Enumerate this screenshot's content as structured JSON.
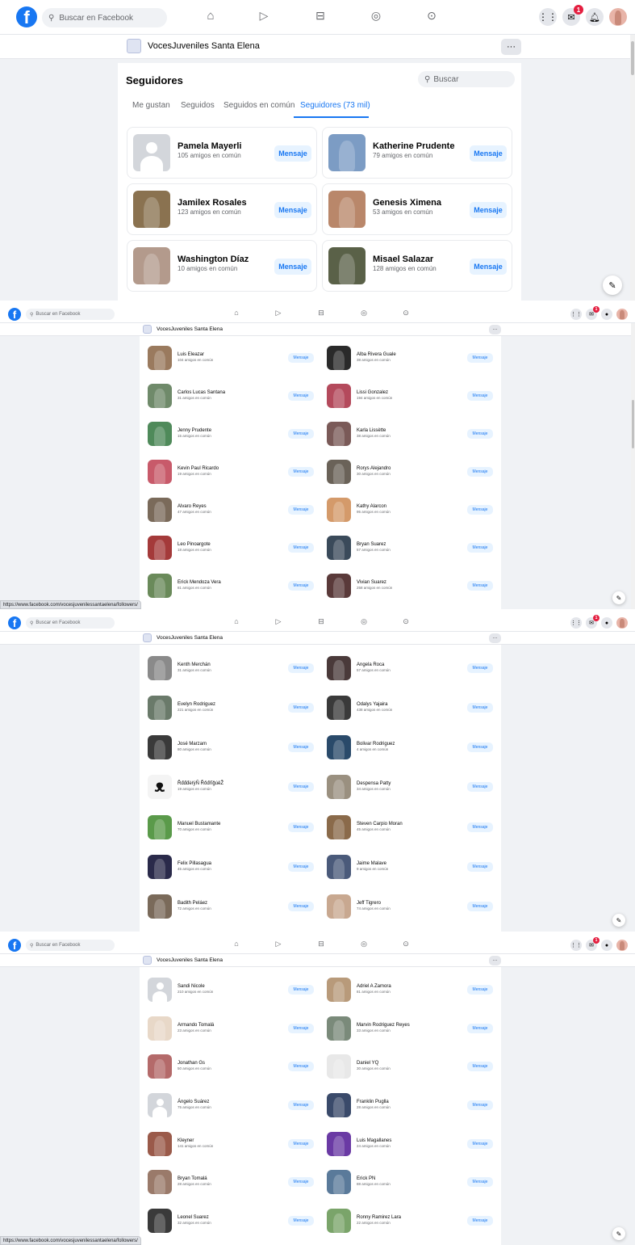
{
  "top": {
    "search_placeholder": "Buscar en Facebook",
    "logo_letter": "f",
    "badge": "1",
    "nav_icons": [
      "home-icon",
      "watch-icon",
      "marketplace-icon",
      "groups-icon",
      "gaming-icon"
    ],
    "right_icons": [
      "menu-grid-icon",
      "messenger-icon",
      "notifications-icon",
      "profile-avatar"
    ]
  },
  "page": {
    "name": "VocesJuveniles Santa Elena",
    "more": "···"
  },
  "panel": {
    "title": "Seguidores",
    "search_placeholder": "Buscar",
    "tabs": [
      "Me gustan",
      "Seguidos",
      "Seguidos en común",
      "Seguidores (73 mil)"
    ],
    "active_tab": 3
  },
  "message_label": "Mensaje",
  "status_url": "https://www.facebook.com/vocesjuvenilessantaelena/followers/",
  "shots": [
    {
      "rows": [
        [
          {
            "name": "Pamela Mayerli",
            "mutual": "105 amigos en común",
            "thumb": "#d3d6db",
            "placeholder": true
          },
          {
            "name": "Katherine Prudente",
            "mutual": "79 amigos en común",
            "thumb": "#7c9cc4"
          }
        ],
        [
          {
            "name": "Jamilex Rosales",
            "mutual": "123 amigos en común",
            "thumb": "#8a7250"
          },
          {
            "name": "Genesis Ximena",
            "mutual": "53 amigos en común",
            "thumb": "#b9876a"
          }
        ],
        [
          {
            "name": "Washington Díaz",
            "mutual": "10 amigos en común",
            "thumb": "#b39a8c"
          },
          {
            "name": "Misael Salazar",
            "mutual": "128 amigos en común",
            "thumb": "#5a6148"
          }
        ]
      ]
    },
    {
      "rows": [
        [
          {
            "name": "Luis Eleazar",
            "mutual": "104 amigos en común",
            "thumb": "#9a7a5e"
          },
          {
            "name": "Alba Rivera Guale",
            "mutual": "38 amigos en común",
            "thumb": "#2a2a2a"
          }
        ],
        [
          {
            "name": "Carlos Lucas Santana",
            "mutual": "31 amigos en común",
            "thumb": "#6f8a6a"
          },
          {
            "name": "Lissi Gonzalez",
            "mutual": "194 amigos en común",
            "thumb": "#b44a5c"
          }
        ],
        [
          {
            "name": "Jenny Prudente",
            "mutual": "15 amigos en común",
            "thumb": "#4f8a5a"
          },
          {
            "name": "Karla Lissètte",
            "mutual": "38 amigos en común",
            "thumb": "#7a5a58"
          }
        ],
        [
          {
            "name": "Kevin Paul Ricardo",
            "mutual": "19 amigos en común",
            "thumb": "#c85a6a"
          },
          {
            "name": "Rorys Alejandro",
            "mutual": "30 amigos en común",
            "thumb": "#6a6258"
          }
        ],
        [
          {
            "name": "Alvaro Reyes",
            "mutual": "47 amigos en común",
            "thumb": "#7a6a5a"
          },
          {
            "name": "Kathy Alarcon",
            "mutual": "95 amigos en común",
            "thumb": "#d49a6a"
          }
        ],
        [
          {
            "name": "Leo Pinoargote",
            "mutual": "18 amigos en común",
            "thumb": "#a43a3a"
          },
          {
            "name": "Bryan Suarez",
            "mutual": "57 amigos en común",
            "thumb": "#3a4a5a"
          }
        ],
        [
          {
            "name": "Erick Mendoza Vera",
            "mutual": "81 amigos en común",
            "thumb": "#6a8a5a"
          },
          {
            "name": "Vivian Suarez",
            "mutual": "258 amigos en común",
            "thumb": "#5a3a3a"
          }
        ]
      ]
    },
    {
      "rows": [
        [
          {
            "name": "Kenth Merchán",
            "mutual": "31 amigos en común",
            "thumb": "#8a8a8a"
          },
          {
            "name": "Angela Roca",
            "mutual": "57 amigos en común",
            "thumb": "#4a3a3a"
          }
        ],
        [
          {
            "name": "Evelyn Rodriguez",
            "mutual": "221 amigos en común",
            "thumb": "#6a7a6a"
          },
          {
            "name": "Odalys Yajaira",
            "mutual": "438 amigos en común",
            "thumb": "#3a3a3a"
          }
        ],
        [
          {
            "name": "José Marzam",
            "mutual": "80 amigos en común",
            "thumb": "#3a3a3a"
          },
          {
            "name": "Bolivar Rodriguez",
            "mutual": "4 amigos en común",
            "thumb": "#2a4a6a"
          }
        ],
        [
          {
            "name": "ŘđđđėŕýŇ ŘőđŕĭğúěŽ",
            "mutual": "19 amigos en común",
            "thumb": "#f4f4f4",
            "ribbon": true
          },
          {
            "name": "Despensa Patty",
            "mutual": "34 amigos en común",
            "thumb": "#9a9080"
          }
        ],
        [
          {
            "name": "Manuel Bustamante",
            "mutual": "70 amigos en común",
            "thumb": "#5a9a4a"
          },
          {
            "name": "Steven Carpio Moran",
            "mutual": "45 amigos en común",
            "thumb": "#8a6a4a"
          }
        ],
        [
          {
            "name": "Felix Pillasagua",
            "mutual": "45 amigos en común",
            "thumb": "#2a2a4a"
          },
          {
            "name": "Jaime Malave",
            "mutual": "9 amigos en común",
            "thumb": "#4a5a7a"
          }
        ],
        [
          {
            "name": "Badith Peláez",
            "mutual": "72 amigos en común",
            "thumb": "#7a6a5a"
          },
          {
            "name": "Jeff Tigrero",
            "mutual": "74 amigos en común",
            "thumb": "#c8a890"
          }
        ]
      ]
    },
    {
      "rows": [
        [
          {
            "name": "Sandi Nicole",
            "mutual": "210 amigos en común",
            "thumb": "#d3d6db",
            "placeholder": true
          },
          {
            "name": "Adriel A Zamora",
            "mutual": "81 amigos en común",
            "thumb": "#b89a7a"
          }
        ],
        [
          {
            "name": "Armando Tomalá",
            "mutual": "23 amigos en común",
            "thumb": "#e8d8c8"
          },
          {
            "name": "Marvin Rodriguez Reyes",
            "mutual": "33 amigos en común",
            "thumb": "#7a8a7a"
          }
        ],
        [
          {
            "name": "Jonathan Gs",
            "mutual": "50 amigos en común",
            "thumb": "#b46a6a"
          },
          {
            "name": "Daniel YQ",
            "mutual": "30 amigos en común",
            "thumb": "#e8e8e8"
          }
        ],
        [
          {
            "name": "Ángelo Suárez",
            "mutual": "75 amigos en común",
            "thumb": "#d3d6db",
            "placeholder": true
          },
          {
            "name": "Franklin Puglla",
            "mutual": "28 amigos en común",
            "thumb": "#3a4a6a"
          }
        ],
        [
          {
            "name": "Kleyner",
            "mutual": "141 amigos en común",
            "thumb": "#9a5a4a"
          },
          {
            "name": "Luis Magallanes",
            "mutual": "24 amigos en común",
            "thumb": "#6a3aa4"
          }
        ],
        [
          {
            "name": "Bryan Tomalá",
            "mutual": "28 amigos en común",
            "thumb": "#9a7a6a"
          },
          {
            "name": "Erick PN",
            "mutual": "88 amigos en común",
            "thumb": "#5a7a9a"
          }
        ],
        [
          {
            "name": "Leonel Suarez",
            "mutual": "32 amigos en común",
            "thumb": "#3a3a3a"
          },
          {
            "name": "Ronny Ramirez Lara",
            "mutual": "22 amigos en común",
            "thumb": "#7aa46a"
          }
        ]
      ]
    }
  ]
}
